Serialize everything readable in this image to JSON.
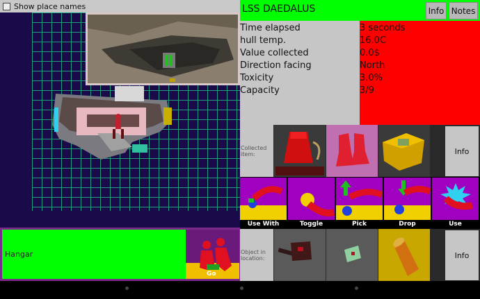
{
  "map": {
    "show_place_names_label": "Show place names"
  },
  "location": {
    "name": "Hangar",
    "go_label": "Go"
  },
  "header": {
    "title": "LSS DAEDALUS",
    "info_button": "Info",
    "notes_button": "Notes"
  },
  "stats": [
    {
      "label": "Time elapsed",
      "value": "3 seconds"
    },
    {
      "label": "hull temp.",
      "value": "16.0C"
    },
    {
      "label": "Value collected",
      "value": "0.0$"
    },
    {
      "label": "Direction facing",
      "value": "North"
    },
    {
      "label": "Toxicity",
      "value": "3.0%"
    },
    {
      "label": "Capacity",
      "value": "3/9"
    }
  ],
  "collected": {
    "label": "Collected item:",
    "info_button": "Info"
  },
  "actions": [
    {
      "label": "Use With"
    },
    {
      "label": "Toggle"
    },
    {
      "label": "Pick"
    },
    {
      "label": "Drop"
    },
    {
      "label": "Use"
    }
  ],
  "object_in_location": {
    "label": "Object in location:",
    "info_button": "Info"
  },
  "colors": {
    "accent_green": "#00ff00",
    "stats_red": "#ff0000",
    "action_purple": "#a000c0"
  }
}
